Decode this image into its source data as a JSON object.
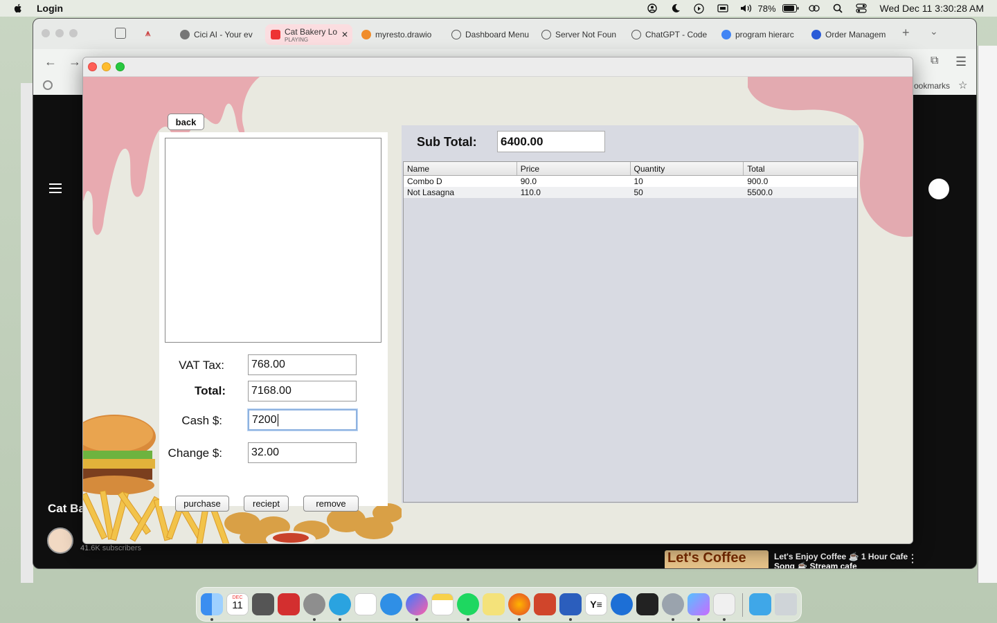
{
  "menubar": {
    "app_name": "Login",
    "battery": "78%",
    "clock": "Wed Dec 11  3:30:28 AM"
  },
  "browser": {
    "tabs": [
      {
        "label": "Cici AI - Your ev",
        "color": "#777777"
      },
      {
        "label": "Cat Bakery Lo",
        "sub": "PLAYING",
        "color": "#e33"
      },
      {
        "label": "myresto.drawio",
        "color": "#f08c2a"
      },
      {
        "label": "Dashboard Menu",
        "color": "#555555"
      },
      {
        "label": "Server Not Foun",
        "color": "#555555"
      },
      {
        "label": "ChatGPT - Code",
        "color": "#555555"
      },
      {
        "label": "program hierarc",
        "color": "#4285f4"
      },
      {
        "label": "Order Managem",
        "color": "#2a5bd7"
      }
    ],
    "bookmarks_label": "ookmarks",
    "channel_name": "Cat Ba",
    "subscribers": "41.6K subscribers",
    "promo_thumb": "Let's Coffee",
    "promo_title": "Let's Enjoy Coffee ☕ 1 Hour Cafe Song ☕ Stream cafe"
  },
  "app": {
    "back_label": "back",
    "vat_label": "VAT Tax:",
    "vat_value": "768.00",
    "total_label": "Total:",
    "total_value": "7168.00",
    "cash_label": "Cash $:",
    "cash_value": "7200",
    "change_label": "Change $:",
    "change_value": "32.00",
    "purchase_label": "purchase",
    "receipt_label": "reciept",
    "remove_label": "remove",
    "subtotal_label": "Sub Total:",
    "subtotal_value": "6400.00",
    "table": {
      "headers": [
        "Name",
        "Price",
        "Quantity",
        "Total"
      ],
      "rows": [
        [
          "Combo D",
          "90.0",
          "10",
          "900.0"
        ],
        [
          "Not Lasagna",
          "110.0",
          "50",
          "5500.0"
        ]
      ]
    }
  },
  "dock": {
    "apps": [
      "finder",
      "calendar",
      "calculator",
      "photo-booth",
      "system-settings",
      "telegram",
      "reminders",
      "safari",
      "messenger",
      "notes",
      "spotify",
      "stickies",
      "firefox",
      "powerpoint",
      "word",
      "ys",
      "quicktime",
      "terminal",
      "system-preferences",
      "cube",
      "java",
      "downloads",
      "trash"
    ],
    "calendar_month": "DEC",
    "calendar_day": "11"
  },
  "colors": {
    "drip_pink": "#e8aab0",
    "right_panel": "#d8dae2",
    "app_bg": "#e9e9e0"
  }
}
